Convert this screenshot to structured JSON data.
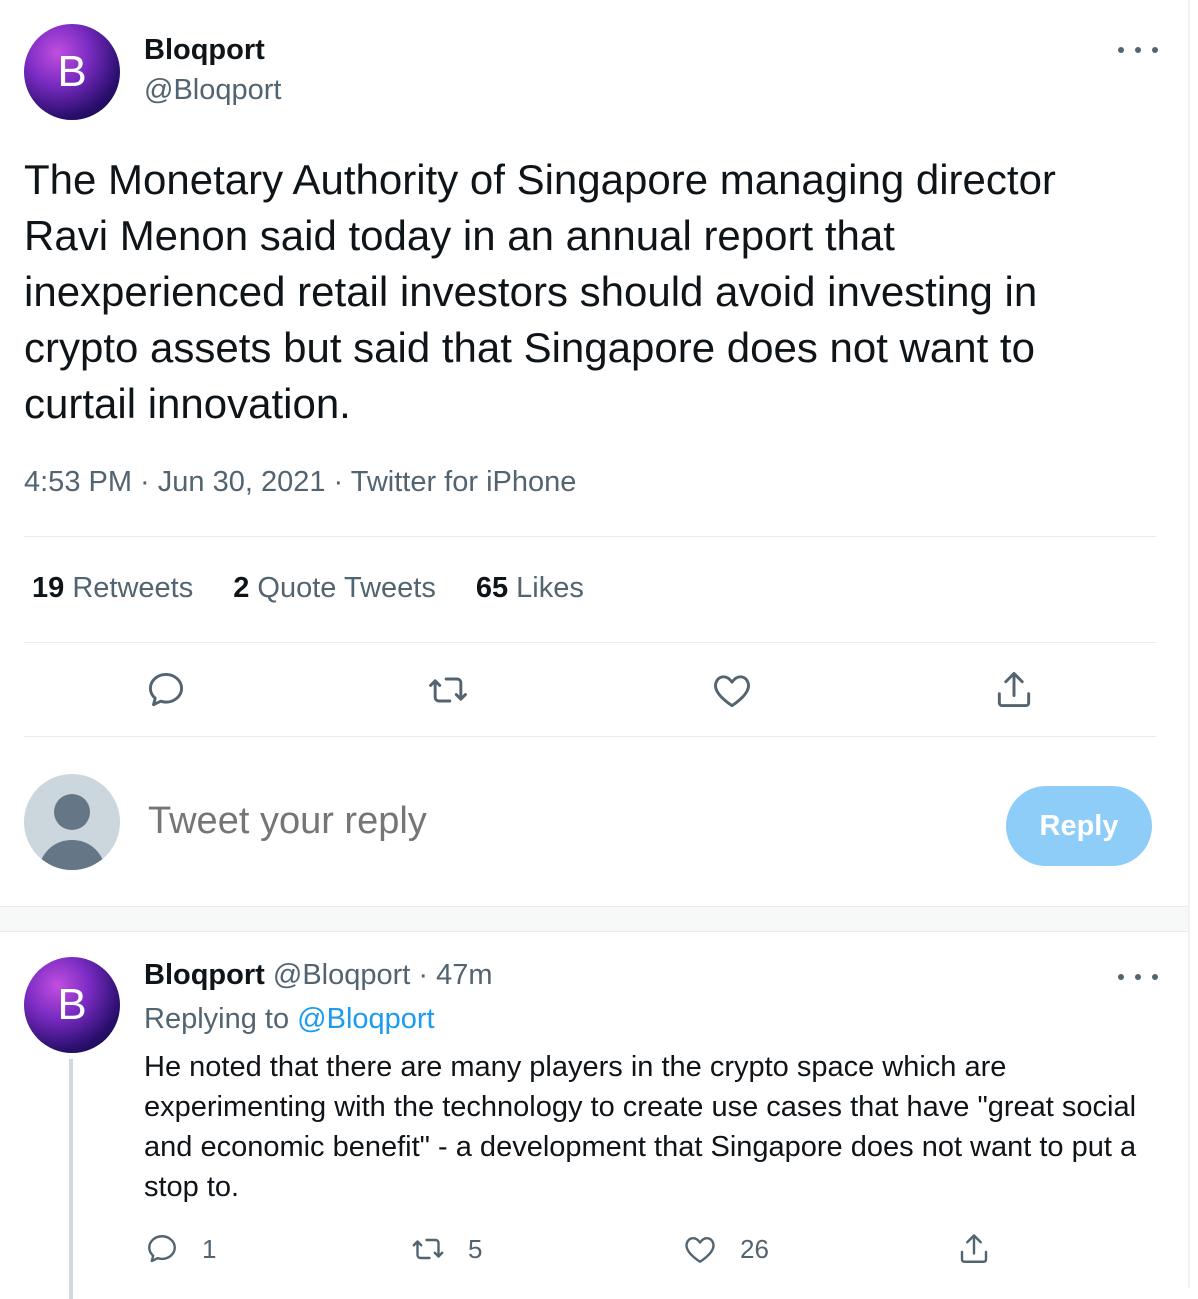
{
  "main_tweet": {
    "avatar_letter": "B",
    "display_name": "Bloqport",
    "handle": "@Bloqport",
    "text": "The Monetary Authority of Singapore managing director Ravi Menon said today in an annual report that inexperienced retail investors should avoid investing in crypto assets but said that Singapore does not want to curtail innovation.",
    "meta": "4:53 PM · Jun 30, 2021 · Twitter for iPhone",
    "stats": {
      "retweets_count": "19",
      "retweets_label": "Retweets",
      "quotes_count": "2",
      "quotes_label": "Quote Tweets",
      "likes_count": "65",
      "likes_label": "Likes"
    },
    "actions": [
      "reply-icon",
      "retweet-icon",
      "like-icon",
      "share-icon"
    ]
  },
  "reply_composer": {
    "placeholder": "Tweet your reply",
    "button_label": "Reply"
  },
  "reply_tweet": {
    "avatar_letter": "B",
    "display_name": "Bloqport",
    "handle_time": "@Bloqport · 47m",
    "replying_prefix": "Replying to",
    "replying_handle": "@Bloqport",
    "text": "He noted that there are many players in the crypto space which are experimenting with the technology to create use cases that have \"great social and economic benefit\" - a development that Singapore does not want to put a stop to.",
    "reply_count": "1",
    "retweet_count": "5",
    "like_count": "26"
  },
  "colors": {
    "text": "#0f1419",
    "secondary": "#536471",
    "link": "#1d9bf0",
    "reply_button_disabled": "#8ecdf8",
    "divider": "#e6ecf0"
  }
}
